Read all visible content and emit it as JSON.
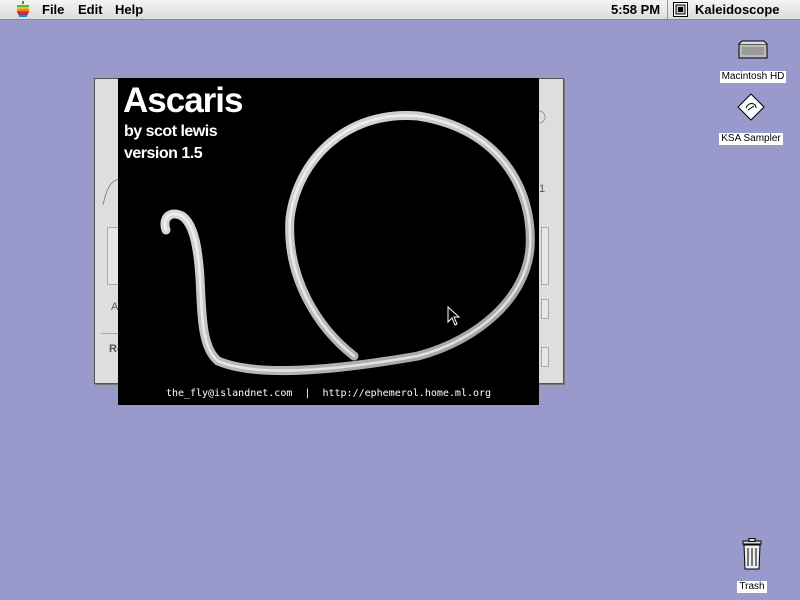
{
  "menubar": {
    "apple_icon": "apple-logo-icon",
    "menus": [
      "File",
      "Edit",
      "Help"
    ],
    "clock": "5:58 PM",
    "active_app": "Kaleidoscope"
  },
  "splash": {
    "title": "Ascaris",
    "author": "by scot lewis",
    "version": "version 1.5",
    "footer": "the_fly@islandnet.com  |  http://ephemerol.home.ml.org"
  },
  "desktop": {
    "icons": [
      {
        "label": "Macintosh HD",
        "icon": "hard-disk-icon"
      },
      {
        "label": "KSA Sampler",
        "icon": "scheme-file-icon"
      },
      {
        "label": "Trash",
        "icon": "trash-icon"
      }
    ]
  },
  "background_dialog": {
    "partial_text": [
      "1",
      "A",
      "Re"
    ]
  },
  "colors": {
    "desktop": "#9999cc",
    "splash_bg": "#000000",
    "menubar": "#e6e6e6"
  }
}
